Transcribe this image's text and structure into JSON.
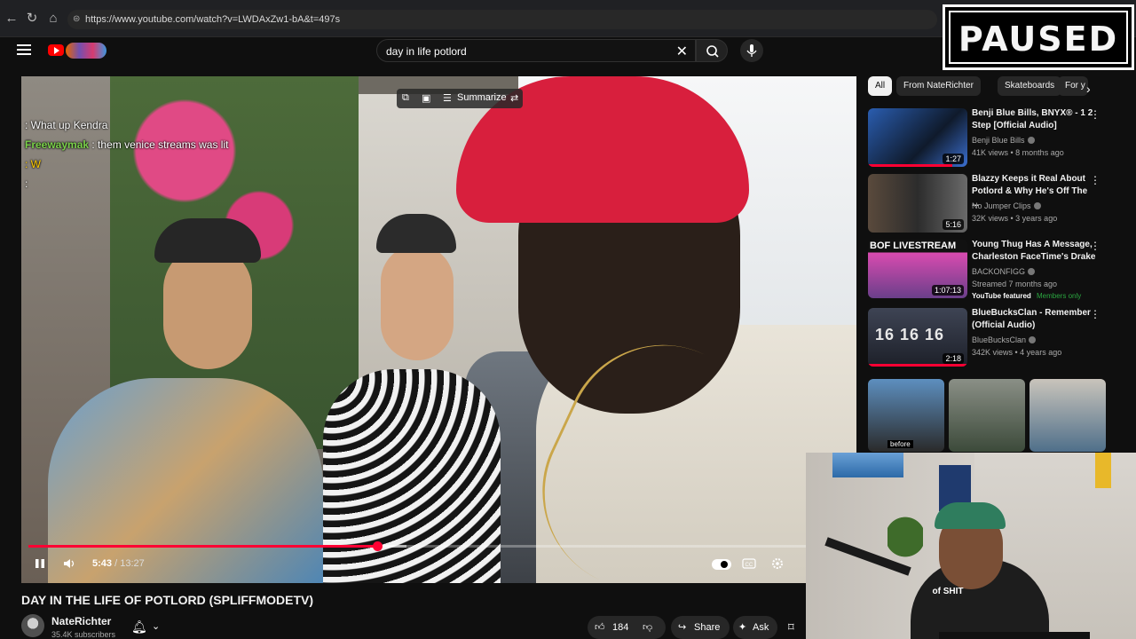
{
  "browser": {
    "url": "https://www.youtube.com/watch?v=LWDAxZw1-bA&t=497s"
  },
  "search": {
    "query": "day in life potlord"
  },
  "overlay": {
    "paused_text": "PAUSED"
  },
  "chat": [
    {
      "user": "",
      "message": ": What up Kendra",
      "color": "#4aa3ff"
    },
    {
      "user": "Freewaymak",
      "message": ": them venice streams was lit",
      "color": "#7ad04a"
    },
    {
      "user": "",
      "message": ": W",
      "color": "#b06bff"
    },
    {
      "user": "",
      "message": ":",
      "color": "#5d6bff"
    }
  ],
  "player": {
    "summarize_label": "Summarize",
    "current_time": "5:43",
    "duration": "13:27",
    "progress_fraction": 0.425,
    "buffered_fraction": 0.46
  },
  "video": {
    "title": "DAY IN THE LIFE OF POTLORD (SPLIFFMODETV)",
    "channel": "NateRichter",
    "subscribers": "35.4K subscribers",
    "likes": "184",
    "share_label": "Share",
    "ask_label": "Ask"
  },
  "chips": [
    "All",
    "From NateRichter",
    "Skateboards",
    "For y"
  ],
  "recommendations": [
    {
      "title": "Benji Blue Bills, BNYX® - 1 2 Step [Official Audio]",
      "channel": "Benji Blue Bills",
      "meta": "41K views • 8 months ago",
      "duration": "1:27",
      "watched_fraction": 0.85
    },
    {
      "title": "Blazzy Keeps it Real About Potlord & Why He's Off The ...",
      "channel": "No Jumper Clips",
      "meta": "32K views • 3 years ago",
      "duration": "5:16",
      "watched_fraction": 0.0
    },
    {
      "title": "Young Thug Has A Message, Charleston FaceTime's Drake",
      "channel": "BACKONFIGG",
      "meta": "Streamed 7 months ago",
      "duration": "1:07:13",
      "watched_fraction": 0.0,
      "featured": "YouTube featured",
      "members": "Members only",
      "thumb_text": "BOF LIVESTREAM"
    },
    {
      "title": "BlueBucksClan - Remember (Official Audio)",
      "channel": "BlueBucksClan",
      "meta": "342K views • 4 years ago",
      "duration": "2:18",
      "watched_fraction": 1.0,
      "thumb_text": "16 16 16"
    }
  ],
  "shorts": [
    {
      "caption": "before"
    },
    {
      "caption": ""
    },
    {
      "caption": ""
    }
  ],
  "webcam": {
    "shirt_text": "of SHIT"
  },
  "colors": {
    "accent": "#ff0033",
    "bg": "#0f0f0f"
  }
}
